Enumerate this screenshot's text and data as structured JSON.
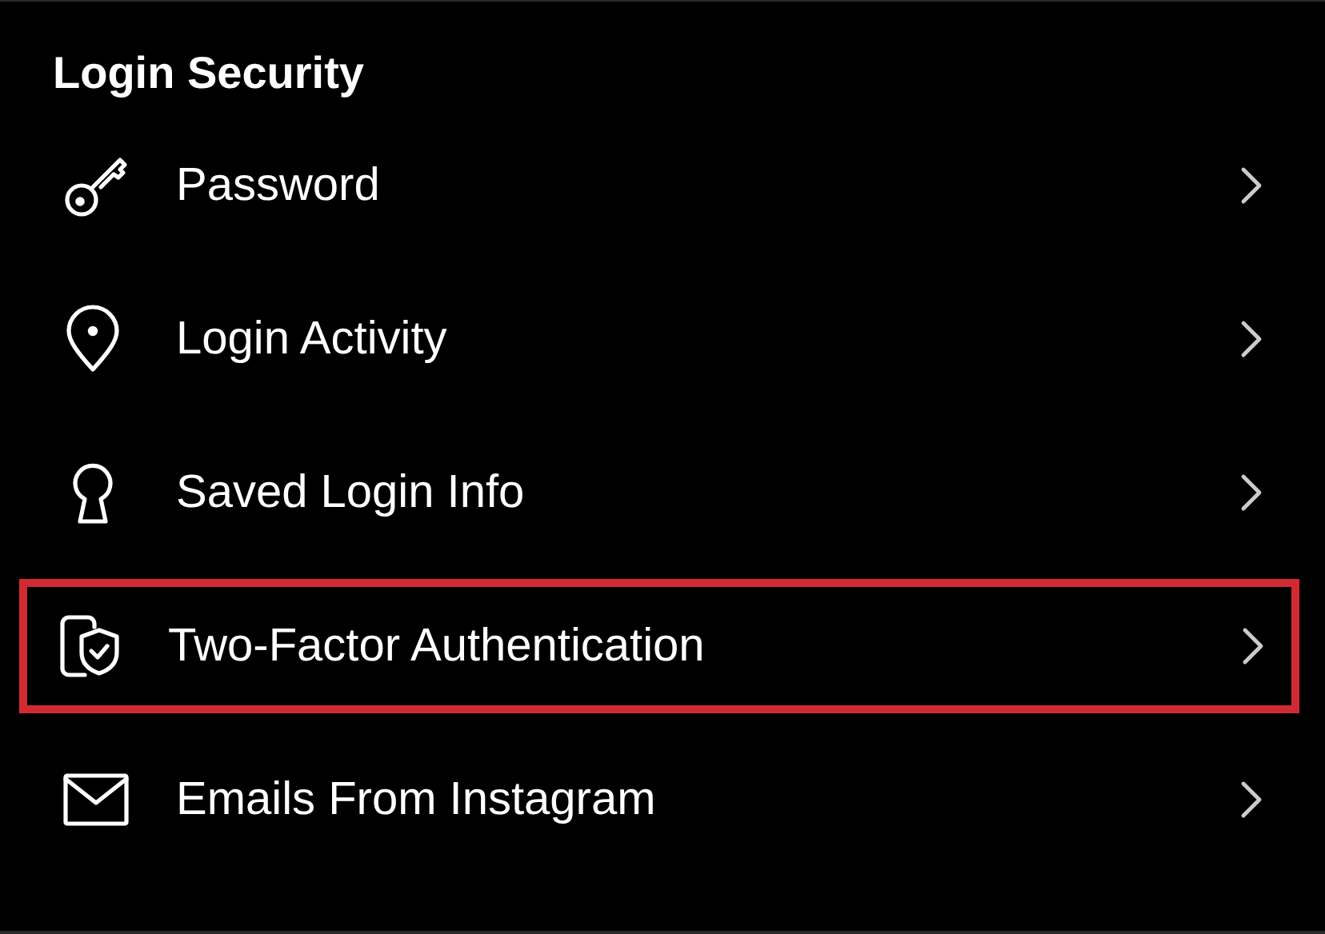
{
  "section": {
    "title": "Login Security"
  },
  "items": [
    {
      "label": "Password",
      "highlighted": false
    },
    {
      "label": "Login Activity",
      "highlighted": false
    },
    {
      "label": "Saved Login Info",
      "highlighted": false
    },
    {
      "label": "Two-Factor Authentication",
      "highlighted": true
    },
    {
      "label": "Emails From Instagram",
      "highlighted": false
    }
  ]
}
